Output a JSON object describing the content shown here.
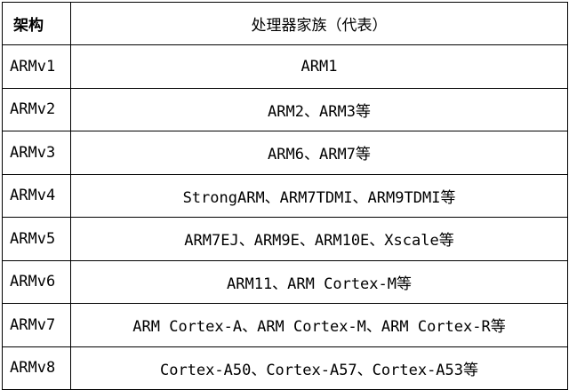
{
  "table": {
    "headers": {
      "arch": "架构",
      "family": "处理器家族（代表）"
    },
    "rows": [
      {
        "arch": "ARMv1",
        "family": "ARM1"
      },
      {
        "arch": "ARMv2",
        "family": "ARM2、ARM3等"
      },
      {
        "arch": "ARMv3",
        "family": "ARM6、ARM7等"
      },
      {
        "arch": "ARMv4",
        "family": "StrongARM、ARM7TDMI、ARM9TDMI等"
      },
      {
        "arch": "ARMv5",
        "family": "ARM7EJ、ARM9E、ARM10E、Xscale等"
      },
      {
        "arch": "ARMv6",
        "family": "ARM11、ARM Cortex-M等"
      },
      {
        "arch": "ARMv7",
        "family": "ARM Cortex-A、ARM Cortex-M、ARM Cortex-R等"
      },
      {
        "arch": "ARMv8",
        "family": "Cortex-A50、Cortex-A57、Cortex-A53等"
      }
    ]
  }
}
